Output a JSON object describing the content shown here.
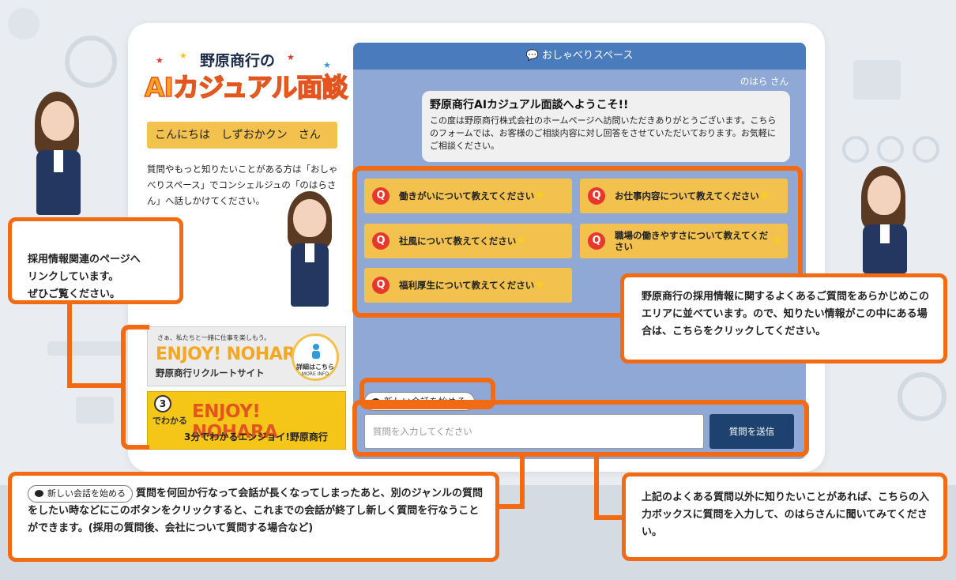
{
  "logo": {
    "top": "野原商行の",
    "main": "AIカジュアル面談"
  },
  "greeting": "こんにちは　しずおかクン　さん",
  "intro": "質問やもっと知りたいことがある方は「おしゃべりスペース」でコンシェルジュの「のはらさん」へ話しかけてください。",
  "banners": {
    "recruit": {
      "small": "さぁ、私たちと一緒に仕事を楽しもう。",
      "big": "ENJOY! NOHARA",
      "sub": "野原商行リクルートサイト",
      "badge": "詳細はこちら",
      "badge_sub": "MORE INFO"
    },
    "video": {
      "num": "3",
      "wakaru": "でわかる",
      "big": "ENJOY! NOHARA",
      "sub": "3分でわかるエンジョイ!野原商行"
    }
  },
  "chat": {
    "header": "おしゃべりスペース",
    "name": "のはら さん",
    "bubble_title": "野原商行AIカジュアル面談へようこそ!!",
    "bubble_text": "この度は野原商行株式会社のホームページへ訪問いただきありがとうございます。こちらのフォームでは、お客様のご相談内容に対し回答をさせていただいております。お気軽にご相談ください。",
    "questions": [
      "働きがいについて教えてください",
      "お仕事内容について教えてください",
      "社風について教えてください",
      "職場の働きやすさについて教えてください",
      "福利厚生について教えてください"
    ],
    "new_conversation": "新しい会話を始める",
    "input_placeholder": "質問を入力してください",
    "send": "質問を送信"
  },
  "callouts": {
    "links": "採用情報関連のページへ\nリンクしています。\nぜひご覧ください。",
    "faq": "野原商行の採用情報に関するよくあるご質問をあらかじめこのエリアに並べています。ので、知りたい情報がこの中にある場合は、こちらをクリックしてください。",
    "new_conv_pill": "新しい会話を始める",
    "new_conv": "質問を何回か行なって会話が長くなってしまったあと、別のジャンルの質問をしたい時などにこのボタンをクリックすると、これまでの会話が終了し新しく質問を行なうことができます。(採用の質問後、会社について質問する場合など)",
    "input": "上記のよくある質問以外に知りたいことがあれば、こちらの入力ボックスに質問を入力して、のはらさんに聞いてみてください。"
  },
  "colors": {
    "accent": "#f26a11",
    "chat_bg": "#8fa8d6",
    "header": "#4a7bbd",
    "button": "#f2c14e",
    "send": "#1e4270"
  }
}
